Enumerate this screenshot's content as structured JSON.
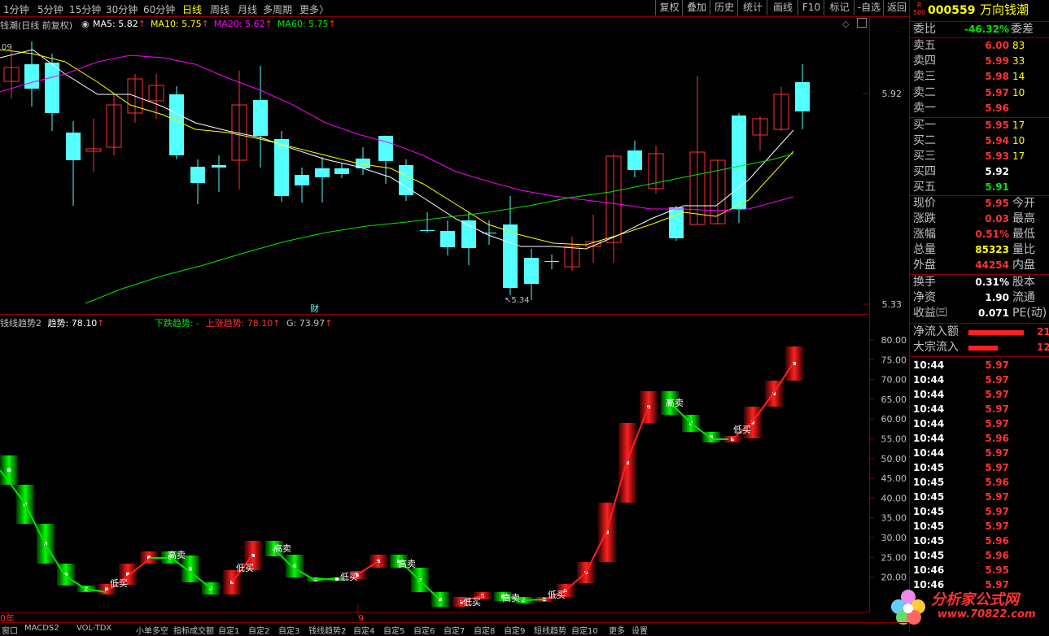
{
  "toolbar": {
    "periods": [
      "1分钟",
      "5分钟",
      "15分钟",
      "30分钟",
      "60分钟",
      "日线",
      "周线",
      "月线",
      "多周期",
      "更多〉"
    ],
    "active_period": "日线",
    "buttons": [
      "复权",
      "叠加",
      "历史",
      "统计",
      "画线",
      "F10",
      "标记",
      "-自选",
      "返回"
    ]
  },
  "main_chart": {
    "title": "钱潮(日线 前复权)",
    "ma_labels": [
      {
        "text": "MA5: 5.82",
        "color": "#ffffff"
      },
      {
        "text": "MA10: 5.75",
        "color": "#ffff00"
      },
      {
        "text": "MA20: 5.62",
        "color": "#ff00ff"
      },
      {
        "text": "MA60: 5.75",
        "color": "#00e600"
      }
    ],
    "corner_label": "09",
    "price_ticks": [
      "5.92",
      "5.33"
    ],
    "low_marker": "5.34",
    "event_marker": "财"
  },
  "indicator": {
    "name": "钱线趋势2",
    "trend_label": "趋势: 78.10",
    "down_label": "下跌趋势: -",
    "up_label": "上涨趋势: 78.10",
    "g_label": "G: 73.97",
    "y_ticks": [
      "80.00",
      "75.00",
      "70.00",
      "65.00",
      "60.00",
      "55.00",
      "50.00",
      "45.00",
      "40.00",
      "35.00",
      "30.00",
      "25.00",
      "20.00"
    ],
    "signal_words": {
      "buy": "低买",
      "sell": "高卖"
    },
    "x_labels": [
      "0年",
      "9"
    ]
  },
  "stock": {
    "badge_top": "R",
    "badge_bottom": "500",
    "code": "000559",
    "name": "万向钱潮",
    "weibi_label": "委比",
    "weibi_value": "-46.32%",
    "weicha_label": "委差",
    "asks": [
      {
        "label": "卖五",
        "price": "6.00",
        "vol": "83"
      },
      {
        "label": "卖四",
        "price": "5.99",
        "vol": "33"
      },
      {
        "label": "卖三",
        "price": "5.98",
        "vol": "14"
      },
      {
        "label": "卖二",
        "price": "5.97",
        "vol": "10"
      },
      {
        "label": "卖一",
        "price": "5.96",
        "vol": ""
      }
    ],
    "bids": [
      {
        "label": "买一",
        "price": "5.95",
        "vol": "17",
        "color": "#ff3232"
      },
      {
        "label": "买二",
        "price": "5.94",
        "vol": "10",
        "color": "#ff3232"
      },
      {
        "label": "买三",
        "price": "5.93",
        "vol": "17",
        "color": "#ff3232"
      },
      {
        "label": "买四",
        "price": "5.92",
        "vol": "",
        "color": "#ffffff"
      },
      {
        "label": "买五",
        "price": "5.91",
        "vol": "",
        "color": "#00e600"
      }
    ],
    "quote": [
      {
        "l1": "现价",
        "v": "5.95",
        "vc": "#ff3232",
        "l2": "今开"
      },
      {
        "l1": "涨跌",
        "v": "0.03",
        "vc": "#ff3232",
        "l2": "最高"
      },
      {
        "l1": "涨幅",
        "v": "0.51%",
        "vc": "#ff3232",
        "l2": "最低"
      },
      {
        "l1": "总量",
        "v": "85323",
        "vc": "#ffff00",
        "l2": "量比"
      },
      {
        "l1": "外盘",
        "v": "44254",
        "vc": "#ff3232",
        "l2": "内盘"
      }
    ],
    "quote2": [
      {
        "l1": "换手",
        "v": "0.31%",
        "vc": "#ffffff",
        "l2": "股本"
      },
      {
        "l1": "净资",
        "v": "1.90",
        "vc": "#ffffff",
        "l2": "流通"
      },
      {
        "l1": "收益㈢",
        "v": "0.071",
        "vc": "#ffffff",
        "l2": "PE(动)"
      }
    ],
    "flows": [
      {
        "label": "净流入额",
        "bar": 0.85,
        "val": "21"
      },
      {
        "label": "大宗流入",
        "bar": 0.45,
        "val": "12"
      }
    ],
    "ticks": [
      {
        "t": "10:44",
        "p": "5.97"
      },
      {
        "t": "10:44",
        "p": "5.97"
      },
      {
        "t": "10:44",
        "p": "5.97"
      },
      {
        "t": "10:44",
        "p": "5.97"
      },
      {
        "t": "10:44",
        "p": "5.97"
      },
      {
        "t": "10:44",
        "p": "5.96"
      },
      {
        "t": "10:44",
        "p": "5.97"
      },
      {
        "t": "10:45",
        "p": "5.97"
      },
      {
        "t": "10:45",
        "p": "5.96"
      },
      {
        "t": "10:45",
        "p": "5.97"
      },
      {
        "t": "10:45",
        "p": "5.97"
      },
      {
        "t": "10:45",
        "p": "5.97"
      },
      {
        "t": "10:45",
        "p": "5.96"
      },
      {
        "t": "10:45",
        "p": "5.96"
      },
      {
        "t": "10:46",
        "p": "5.95"
      },
      {
        "t": "10:46",
        "p": "5.97"
      }
    ]
  },
  "bottom_tabs": [
    "窗口",
    "MACDS2",
    "VOL-TDX",
    "小单多空",
    "指标成交额",
    "自定1",
    "自定2",
    "自定3",
    "钱线趋势2",
    "自定4",
    "自定5",
    "自定6",
    "自定7",
    "自定8",
    "自定9",
    "短线趋势",
    "自定10",
    "更多",
    "设置"
  ],
  "watermark": {
    "line1": "分析家公式网",
    "line2": "www.70822.com"
  }
}
